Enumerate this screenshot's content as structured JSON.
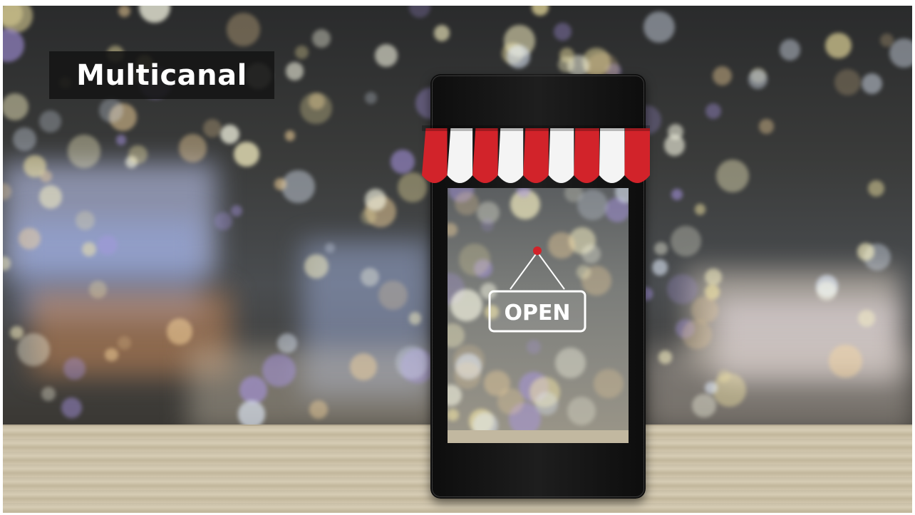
{
  "overlay": {
    "title": "Multicanal"
  },
  "sign": {
    "text": "OPEN"
  },
  "colors": {
    "awning_red": "#d2232a",
    "awning_white": "#f4f4f4",
    "label_bg": "#141414",
    "sign_pin": "#d2232a"
  },
  "icons": {
    "storefront": "awning-storefront-icon",
    "sign": "hanging-open-sign-icon"
  }
}
